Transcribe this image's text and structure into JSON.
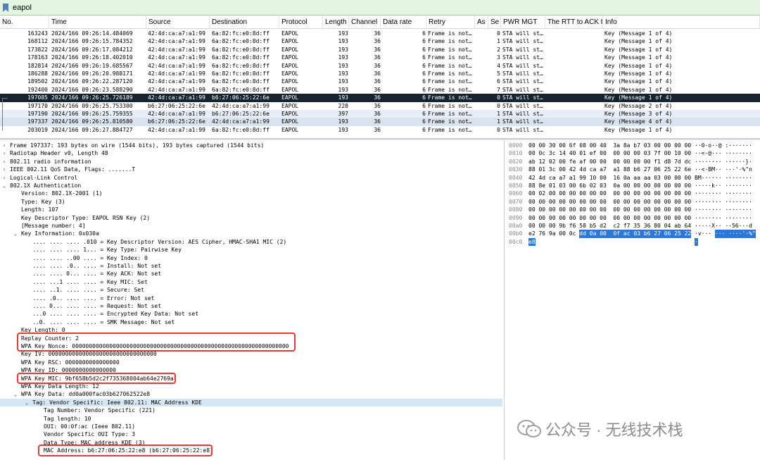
{
  "filter": {
    "value": "eapol"
  },
  "columns": [
    {
      "label": "No."
    },
    {
      "label": "Time"
    },
    {
      "label": "Source"
    },
    {
      "label": "Destination"
    },
    {
      "label": "Protocol"
    },
    {
      "label": "Length"
    },
    {
      "label": "Channel"
    },
    {
      "label": "Data rate"
    },
    {
      "label": "Retry"
    },
    {
      "label": "As"
    },
    {
      "label": "Se"
    },
    {
      "label": "PWR MGT"
    },
    {
      "label": "The RTT to ACK tl"
    },
    {
      "label": "Info"
    }
  ],
  "packets": [
    {
      "no": "163243",
      "time": "2024/166 09:26:14.484069",
      "src": "42:4d:ca:a7:a1:99",
      "dst": "6a:82:fc:e0:8d:ff",
      "proto": "EAPOL",
      "len": "193",
      "ch": "36",
      "rate": "6",
      "retry": "Frame is not…",
      "se": "0",
      "pwr": "STA will st…",
      "info": "Key (Message 1 of 4)",
      "style": "light"
    },
    {
      "no": "168112",
      "time": "2024/166 09:26:15.784352",
      "src": "42:4d:ca:a7:a1:99",
      "dst": "6a:82:fc:e0:8d:ff",
      "proto": "EAPOL",
      "len": "193",
      "ch": "36",
      "rate": "6",
      "retry": "Frame is not…",
      "se": "1",
      "pwr": "STA will st…",
      "info": "Key (Message 1 of 4)",
      "style": "light"
    },
    {
      "no": "173822",
      "time": "2024/166 09:26:17.084212",
      "src": "42:4d:ca:a7:a1:99",
      "dst": "6a:82:fc:e0:8d:ff",
      "proto": "EAPOL",
      "len": "193",
      "ch": "36",
      "rate": "6",
      "retry": "Frame is not…",
      "se": "2",
      "pwr": "STA will st…",
      "info": "Key (Message 1 of 4)",
      "style": "light"
    },
    {
      "no": "178163",
      "time": "2024/166 09:26:18.402010",
      "src": "42:4d:ca:a7:a1:99",
      "dst": "6a:82:fc:e0:8d:ff",
      "proto": "EAPOL",
      "len": "193",
      "ch": "36",
      "rate": "6",
      "retry": "Frame is not…",
      "se": "3",
      "pwr": "STA will st…",
      "info": "Key (Message 1 of 4)",
      "style": "light"
    },
    {
      "no": "182814",
      "time": "2024/166 09:26:19.685567",
      "src": "42:4d:ca:a7:a1:99",
      "dst": "6a:82:fc:e0:8d:ff",
      "proto": "EAPOL",
      "len": "193",
      "ch": "36",
      "rate": "6",
      "retry": "Frame is not…",
      "se": "4",
      "pwr": "STA will st…",
      "info": "Key (Message 1 of 4)",
      "style": "light"
    },
    {
      "no": "186288",
      "time": "2024/166 09:26:20.988171",
      "src": "42:4d:ca:a7:a1:99",
      "dst": "6a:82:fc:e0:8d:ff",
      "proto": "EAPOL",
      "len": "193",
      "ch": "36",
      "rate": "6",
      "retry": "Frame is not…",
      "se": "5",
      "pwr": "STA will st…",
      "info": "Key (Message 1 of 4)",
      "style": "light"
    },
    {
      "no": "189502",
      "time": "2024/166 09:26:22.287120",
      "src": "42:4d:ca:a7:a1:99",
      "dst": "6a:82:fc:e0:8d:ff",
      "proto": "EAPOL",
      "len": "193",
      "ch": "36",
      "rate": "6",
      "retry": "Frame is not…",
      "se": "6",
      "pwr": "STA will st…",
      "info": "Key (Message 1 of 4)",
      "style": "light"
    },
    {
      "no": "192400",
      "time": "2024/166 09:26:23.588290",
      "src": "42:4d:ca:a7:a1:99",
      "dst": "6a:82:fc:e0:8d:ff",
      "proto": "EAPOL",
      "len": "193",
      "ch": "36",
      "rate": "6",
      "retry": "Frame is not…",
      "se": "7",
      "pwr": "STA will st…",
      "info": "Key (Message 1 of 4)",
      "style": "light"
    },
    {
      "no": "197085",
      "time": "2024/166 09:26:25.726189",
      "src": "42:4d:ca:a7:a1:99",
      "dst": "b6:27:06:25:22:6e",
      "proto": "EAPOL",
      "len": "193",
      "ch": "36",
      "rate": "6",
      "retry": "Frame is not…",
      "se": "0",
      "pwr": "STA will st…",
      "info": "Key (Message 1 of 4)",
      "style": "sel"
    },
    {
      "no": "197170",
      "time": "2024/166 09:26:25.753300",
      "src": "b6:27:06:25:22:6e",
      "dst": "42:4d:ca:a7:a1:99",
      "proto": "EAPOL",
      "len": "228",
      "ch": "36",
      "rate": "6",
      "retry": "Frame is not…",
      "se": "0",
      "pwr": "STA will st…",
      "info": "Key (Message 2 of 4)",
      "style": "light"
    },
    {
      "no": "197190",
      "time": "2024/166 09:26:25.759355",
      "src": "42:4d:ca:a7:a1:99",
      "dst": "b6:27:06:25:22:6e",
      "proto": "EAPOL",
      "len": "397",
      "ch": "36",
      "rate": "6",
      "retry": "Frame is not…",
      "se": "1",
      "pwr": "STA will st…",
      "info": "Key (Message 3 of 4)",
      "style": "blue"
    },
    {
      "no": "197337",
      "time": "2024/166 09:26:25.810580",
      "src": "b6:27:06:25:22:6e",
      "dst": "42:4d:ca:a7:a1:99",
      "proto": "EAPOL",
      "len": "193",
      "ch": "36",
      "rate": "6",
      "retry": "Frame is not…",
      "se": "1",
      "pwr": "STA will st…",
      "info": "Key (Message 4 of 4)",
      "style": "gray"
    },
    {
      "no": "203019",
      "time": "2024/166 09:26:27.884727",
      "src": "42:4d:ca:a7:a1:99",
      "dst": "6a:82:fc:e0:8d:ff",
      "proto": "EAPOL",
      "len": "193",
      "ch": "36",
      "rate": "6",
      "retry": "Frame is not…",
      "se": "0",
      "pwr": "STA will st…",
      "info": "Key (Message 1 of 4)",
      "style": "light"
    }
  ],
  "details": [
    {
      "indent": 0,
      "arrow": ">",
      "text": "Frame 197337: 193 bytes on wire (1544 bits), 193 bytes captured (1544 bits)"
    },
    {
      "indent": 0,
      "arrow": ">",
      "text": "Radiotap Header v0, Length 48"
    },
    {
      "indent": 0,
      "arrow": ">",
      "text": "802.11 radio information"
    },
    {
      "indent": 0,
      "arrow": ">",
      "text": "IEEE 802.11 QoS Data, Flags: .......T"
    },
    {
      "indent": 0,
      "arrow": ">",
      "text": "Logical-Link Control"
    },
    {
      "indent": 0,
      "arrow": "v",
      "text": "802.1X Authentication"
    },
    {
      "indent": 1,
      "arrow": "",
      "text": "Version: 802.1X-2001 (1)"
    },
    {
      "indent": 1,
      "arrow": "",
      "text": "Type: Key (3)"
    },
    {
      "indent": 1,
      "arrow": "",
      "text": "Length: 107"
    },
    {
      "indent": 1,
      "arrow": "",
      "text": "Key Descriptor Type: EAPOL RSN Key (2)"
    },
    {
      "indent": 1,
      "arrow": "",
      "text": "[Message number: 4]"
    },
    {
      "indent": 1,
      "arrow": "v",
      "text": "Key Information: 0x030a"
    },
    {
      "indent": 2,
      "arrow": "",
      "text": ".... .... .... .010 = Key Descriptor Version: AES Cipher, HMAC-SHA1 MIC (2)"
    },
    {
      "indent": 2,
      "arrow": "",
      "text": ".... .... .... 1... = Key Type: Pairwise Key"
    },
    {
      "indent": 2,
      "arrow": "",
      "text": ".... .... ..00 .... = Key Index: 0"
    },
    {
      "indent": 2,
      "arrow": "",
      "text": ".... .... .0.. .... = Install: Not set"
    },
    {
      "indent": 2,
      "arrow": "",
      "text": ".... .... 0... .... = Key ACK: Not set"
    },
    {
      "indent": 2,
      "arrow": "",
      "text": ".... ...1 .... .... = Key MIC: Set"
    },
    {
      "indent": 2,
      "arrow": "",
      "text": ".... ..1. .... .... = Secure: Set"
    },
    {
      "indent": 2,
      "arrow": "",
      "text": ".... .0.. .... .... = Error: Not set"
    },
    {
      "indent": 2,
      "arrow": "",
      "text": ".... 0... .... .... = Request: Not set"
    },
    {
      "indent": 2,
      "arrow": "",
      "text": "...0 .... .... .... = Encrypted Key Data: Not set"
    },
    {
      "indent": 2,
      "arrow": "",
      "text": "..0. .... .... .... = SMK Message: Not set"
    },
    {
      "indent": 1,
      "arrow": "",
      "text": "Key Length: 0"
    },
    {
      "indent": 1,
      "arrow": "",
      "text": "Replay Counter: 2"
    },
    {
      "indent": 1,
      "arrow": "",
      "text": "WPA Key Nonce: 0000000000000000000000000000000000000000000000000000000000000000"
    },
    {
      "indent": 1,
      "arrow": "",
      "text": "Key IV: 00000000000000000000000000000000"
    },
    {
      "indent": 1,
      "arrow": "",
      "text": "WPA Key RSC: 0000000000000000"
    },
    {
      "indent": 1,
      "arrow": "",
      "text": "WPA Key ID: 0000000000000000"
    },
    {
      "indent": 1,
      "arrow": "",
      "text": "WPA Key MIC: 9bf658b5d2c2f735368004ab64e2769a"
    },
    {
      "indent": 1,
      "arrow": "",
      "text": "WPA Key Data Length: 12"
    },
    {
      "indent": 1,
      "arrow": "v",
      "text": "WPA Key Data: dd0a000fac03b627062522e8"
    },
    {
      "indent": 2,
      "arrow": "v",
      "text": "Tag: Vendor Specific: Ieee 802.11: MAC Address KDE",
      "hl": true
    },
    {
      "indent": 3,
      "arrow": "",
      "text": "Tag Number: Vendor Specific (221)"
    },
    {
      "indent": 3,
      "arrow": "",
      "text": "Tag length: 10"
    },
    {
      "indent": 3,
      "arrow": "",
      "text": "OUI: 00:0f:ac (Ieee 802.11)"
    },
    {
      "indent": 3,
      "arrow": "",
      "text": "Vendor Specific OUI Type: 3"
    },
    {
      "indent": 3,
      "arrow": "",
      "text": "Data Type: MAC address KDE (3)"
    },
    {
      "indent": 3,
      "arrow": "",
      "text": "MAC Address: b6:27:06:25:22:e8 (b6:27:06:25:22:e8)"
    }
  ],
  "hex": [
    {
      "off": "0000",
      "bytes": "00 00 30 00 6f 08 00 40  3a 8a b7 03 00 00 00 00",
      "ascii": "··0·o··@ :·······"
    },
    {
      "off": "0010",
      "bytes": "00 0c 3c 14 40 01 ef 00  00 00 00 03 7f 00 10 00",
      "ascii": "··<·@··· ········"
    },
    {
      "off": "0020",
      "bytes": "ab 12 02 00 fe af 00 00  00 00 00 00 f1 d8 7d dc",
      "ascii": "········ ······}·"
    },
    {
      "off": "0030",
      "bytes": "88 01 3c 00 42 4d ca a7  a1 88 b6 27 06 25 22 6e",
      "ascii": "··<·BM·· ···'·%\"n"
    },
    {
      "off": "0040",
      "bytes": "42 4d ca a7 a1 99 10 00  16 0a aa aa 03 00 00 00",
      "ascii": "BM······ ········"
    },
    {
      "off": "0050",
      "bytes": "88 8e 01 03 00 6b 02 03  0a 00 00 00 00 00 00 00",
      "ascii": "·····k·· ········"
    },
    {
      "off": "0060",
      "bytes": "00 02 00 00 00 00 00 00  00 00 00 00 00 00 00 00",
      "ascii": "········ ········"
    },
    {
      "off": "0070",
      "bytes": "00 00 00 00 00 00 00 00  00 00 00 00 00 00 00 00",
      "ascii": "········ ········"
    },
    {
      "off": "0080",
      "bytes": "00 00 00 00 00 00 00 00  00 00 00 00 00 00 00 00",
      "ascii": "········ ········"
    },
    {
      "off": "0090",
      "bytes": "00 00 00 00 00 00 00 00  00 00 00 00 00 00 00 00",
      "ascii": "········ ········"
    },
    {
      "off": "00a0",
      "bytes": "00 00 00 9b f6 58 b5 d2  c2 f7 35 36 80 04 ab 64",
      "ascii": "·····X·· ··56···d"
    },
    {
      "off": "00b0",
      "bytes": "e2 76 9a 00 0c ",
      "bytes_sel": "dd 0a 00  0f ac 03 b6 27 06 25 22",
      "ascii": "·v··· ",
      "ascii_sel": "··· ····'·%\""
    },
    {
      "off": "00c0",
      "bytes": "",
      "bytes_sel": "e8",
      "ascii": "",
      "ascii_sel": "·"
    }
  ],
  "watermark": {
    "text": "公众号 · 无线技术栈"
  }
}
